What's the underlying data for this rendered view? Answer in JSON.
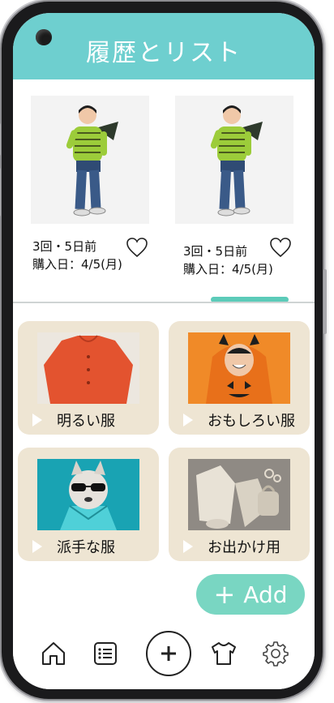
{
  "header": {
    "title": "履歴とリスト"
  },
  "history": [
    {
      "count_text": "3回・5日前",
      "purchase_text": "購入日：4/5(月)"
    },
    {
      "count_text": "3回・5日前",
      "purchase_text": "購入日：4/5(月)"
    }
  ],
  "categories": [
    {
      "label": "明るい服"
    },
    {
      "label": "おもしろい服"
    },
    {
      "label": "派手な服"
    },
    {
      "label": "お出かけ用"
    }
  ],
  "add_button": {
    "label": "Add"
  },
  "nav": {
    "icons": [
      "home-icon",
      "list-icon",
      "plus-icon",
      "shirt-icon",
      "gear-icon"
    ]
  },
  "colors": {
    "header": "#6ecfcf",
    "accent": "#79d6c2",
    "card": "#eee5d3",
    "indicator": "#5ccbb9"
  }
}
